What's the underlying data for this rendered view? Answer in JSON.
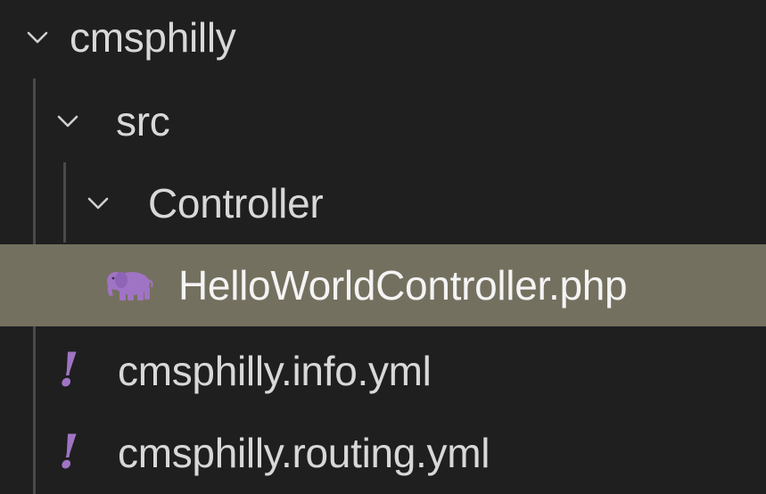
{
  "explorer": {
    "folder_root": {
      "label": "cmsphilly",
      "icon": "chevron-down-icon"
    },
    "folder_src": {
      "label": "src",
      "icon": "chevron-down-icon"
    },
    "folder_controller": {
      "label": "Controller",
      "icon": "chevron-down-icon"
    },
    "file_controller": {
      "label": "HelloWorldController.php",
      "icon": "php-elephant-icon",
      "selected": true
    },
    "file_info": {
      "label": "cmsphilly.info.yml",
      "icon": "yaml-exclamation-icon"
    },
    "file_routing": {
      "label": "cmsphilly.routing.yml",
      "icon": "yaml-exclamation-icon"
    }
  },
  "colors": {
    "background": "#1f1f1f",
    "selection": "#74705f",
    "text": "#d8d8d8",
    "php_icon": "#a074c4",
    "yaml_icon": "#a074c4"
  }
}
